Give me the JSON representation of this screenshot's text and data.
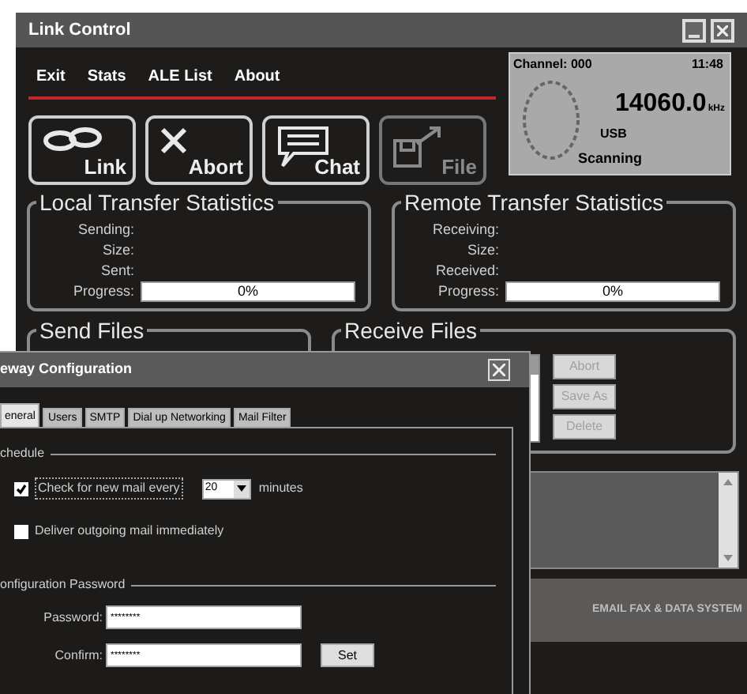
{
  "link_control": {
    "title": "Link Control",
    "menu": [
      "Exit",
      "Stats",
      "ALE List",
      "About"
    ],
    "toolbar": [
      {
        "label": "Link",
        "kind": "link",
        "disabled": false
      },
      {
        "label": "Abort",
        "kind": "abort",
        "disabled": false
      },
      {
        "label": "Chat",
        "kind": "chat",
        "disabled": false
      },
      {
        "label": "File",
        "kind": "file",
        "disabled": true
      }
    ],
    "display": {
      "channel": "Channel: 000",
      "time": "11:48",
      "frequency": "14060.0",
      "unit": "kHz",
      "mode": "USB",
      "status": "Scanning"
    },
    "local_stats": {
      "title": "Local Transfer Statistics",
      "labels": [
        "Sending:",
        "Size:",
        "Sent:"
      ],
      "progress_label": "Progress:",
      "progress_text": "0%",
      "level": 0
    },
    "remote_stats": {
      "title": "Remote Transfer Statistics",
      "labels": [
        "Receiving:",
        "Size:",
        "Received:"
      ],
      "progress_label": "Progress:",
      "progress_text": "0%",
      "level": 0
    },
    "send_files": {
      "title": "Send Files"
    },
    "receive_files": {
      "title": "Receive Files",
      "buttons": [
        {
          "label": "Abort",
          "disabled": true
        },
        {
          "label": "Save As",
          "disabled": true
        },
        {
          "label": "Delete",
          "disabled": true
        }
      ]
    },
    "footer": "EMAIL FAX & DATA SYSTEM"
  },
  "gateway": {
    "title": "eway Configuration",
    "tabs": [
      {
        "label": "eneral",
        "selected": true
      },
      {
        "label": "Users",
        "selected": false
      },
      {
        "label": "SMTP",
        "selected": false
      },
      {
        "label": "Dial up Networking",
        "selected": false
      },
      {
        "label": "Mail Filter",
        "selected": false
      }
    ],
    "schedule": {
      "title": "chedule",
      "check": {
        "label": "Check for new mail every",
        "checked": true
      },
      "interval": "20",
      "unit": "minutes",
      "deliver": {
        "label": "Deliver outgoing mail immediately",
        "checked": false
      }
    },
    "password": {
      "title": "onfiguration Password",
      "fields": [
        {
          "label": "Password:",
          "value": "********"
        },
        {
          "label": "Confirm:",
          "value": "********"
        }
      ],
      "set_button": "Set"
    }
  }
}
